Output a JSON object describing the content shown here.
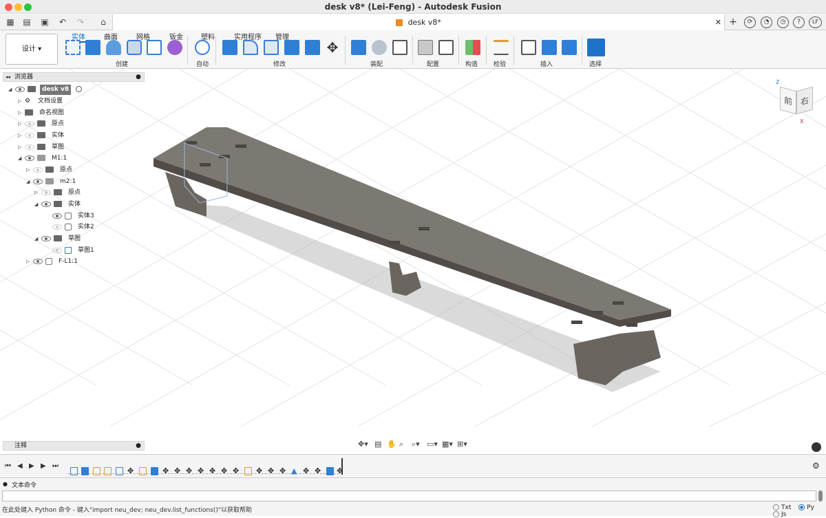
{
  "window": {
    "title": "desk v8* (Lei-Feng) - Autodesk Fusion"
  },
  "doc_tab": {
    "label": "desk v8*"
  },
  "user": {
    "initials": "LF"
  },
  "ribbon": {
    "workspace": "设计",
    "tabs": [
      "实体",
      "曲面",
      "网格",
      "钣金",
      "塑料",
      "实用程序",
      "管理"
    ],
    "groups": [
      "创建",
      "自动",
      "修改",
      "装配",
      "配置",
      "构造",
      "检验",
      "插入",
      "选择"
    ]
  },
  "browser": {
    "header": "浏览器",
    "items": [
      {
        "label": "desk v8"
      },
      {
        "label": "文档设置"
      },
      {
        "label": "命名视图"
      },
      {
        "label": "原点"
      },
      {
        "label": "实体"
      },
      {
        "label": "草图"
      },
      {
        "label": "M1:1"
      },
      {
        "label": "原点"
      },
      {
        "label": "m2:1"
      },
      {
        "label": "原点"
      },
      {
        "label": "实体"
      },
      {
        "label": "实体3"
      },
      {
        "label": "实体2"
      },
      {
        "label": "草图"
      },
      {
        "label": "草图1"
      },
      {
        "label": "F-L1:1"
      }
    ]
  },
  "viewcube": {
    "front": "前",
    "right": "右",
    "axis_z": "Z",
    "axis_x": "X"
  },
  "notes": {
    "header": "注释"
  },
  "text_commands": {
    "header": "文本命令",
    "hint": "在此处键入 Python 命令 - 键入\"import neu_dev; neu_dev.list_functions()\"以获取帮助",
    "modes": [
      "Txt",
      "Py",
      "Js"
    ],
    "selected_mode": "Py"
  },
  "colors": {
    "accent": "#0b6ac1",
    "body": "#6f6a64",
    "body_top": "#7c7872"
  }
}
